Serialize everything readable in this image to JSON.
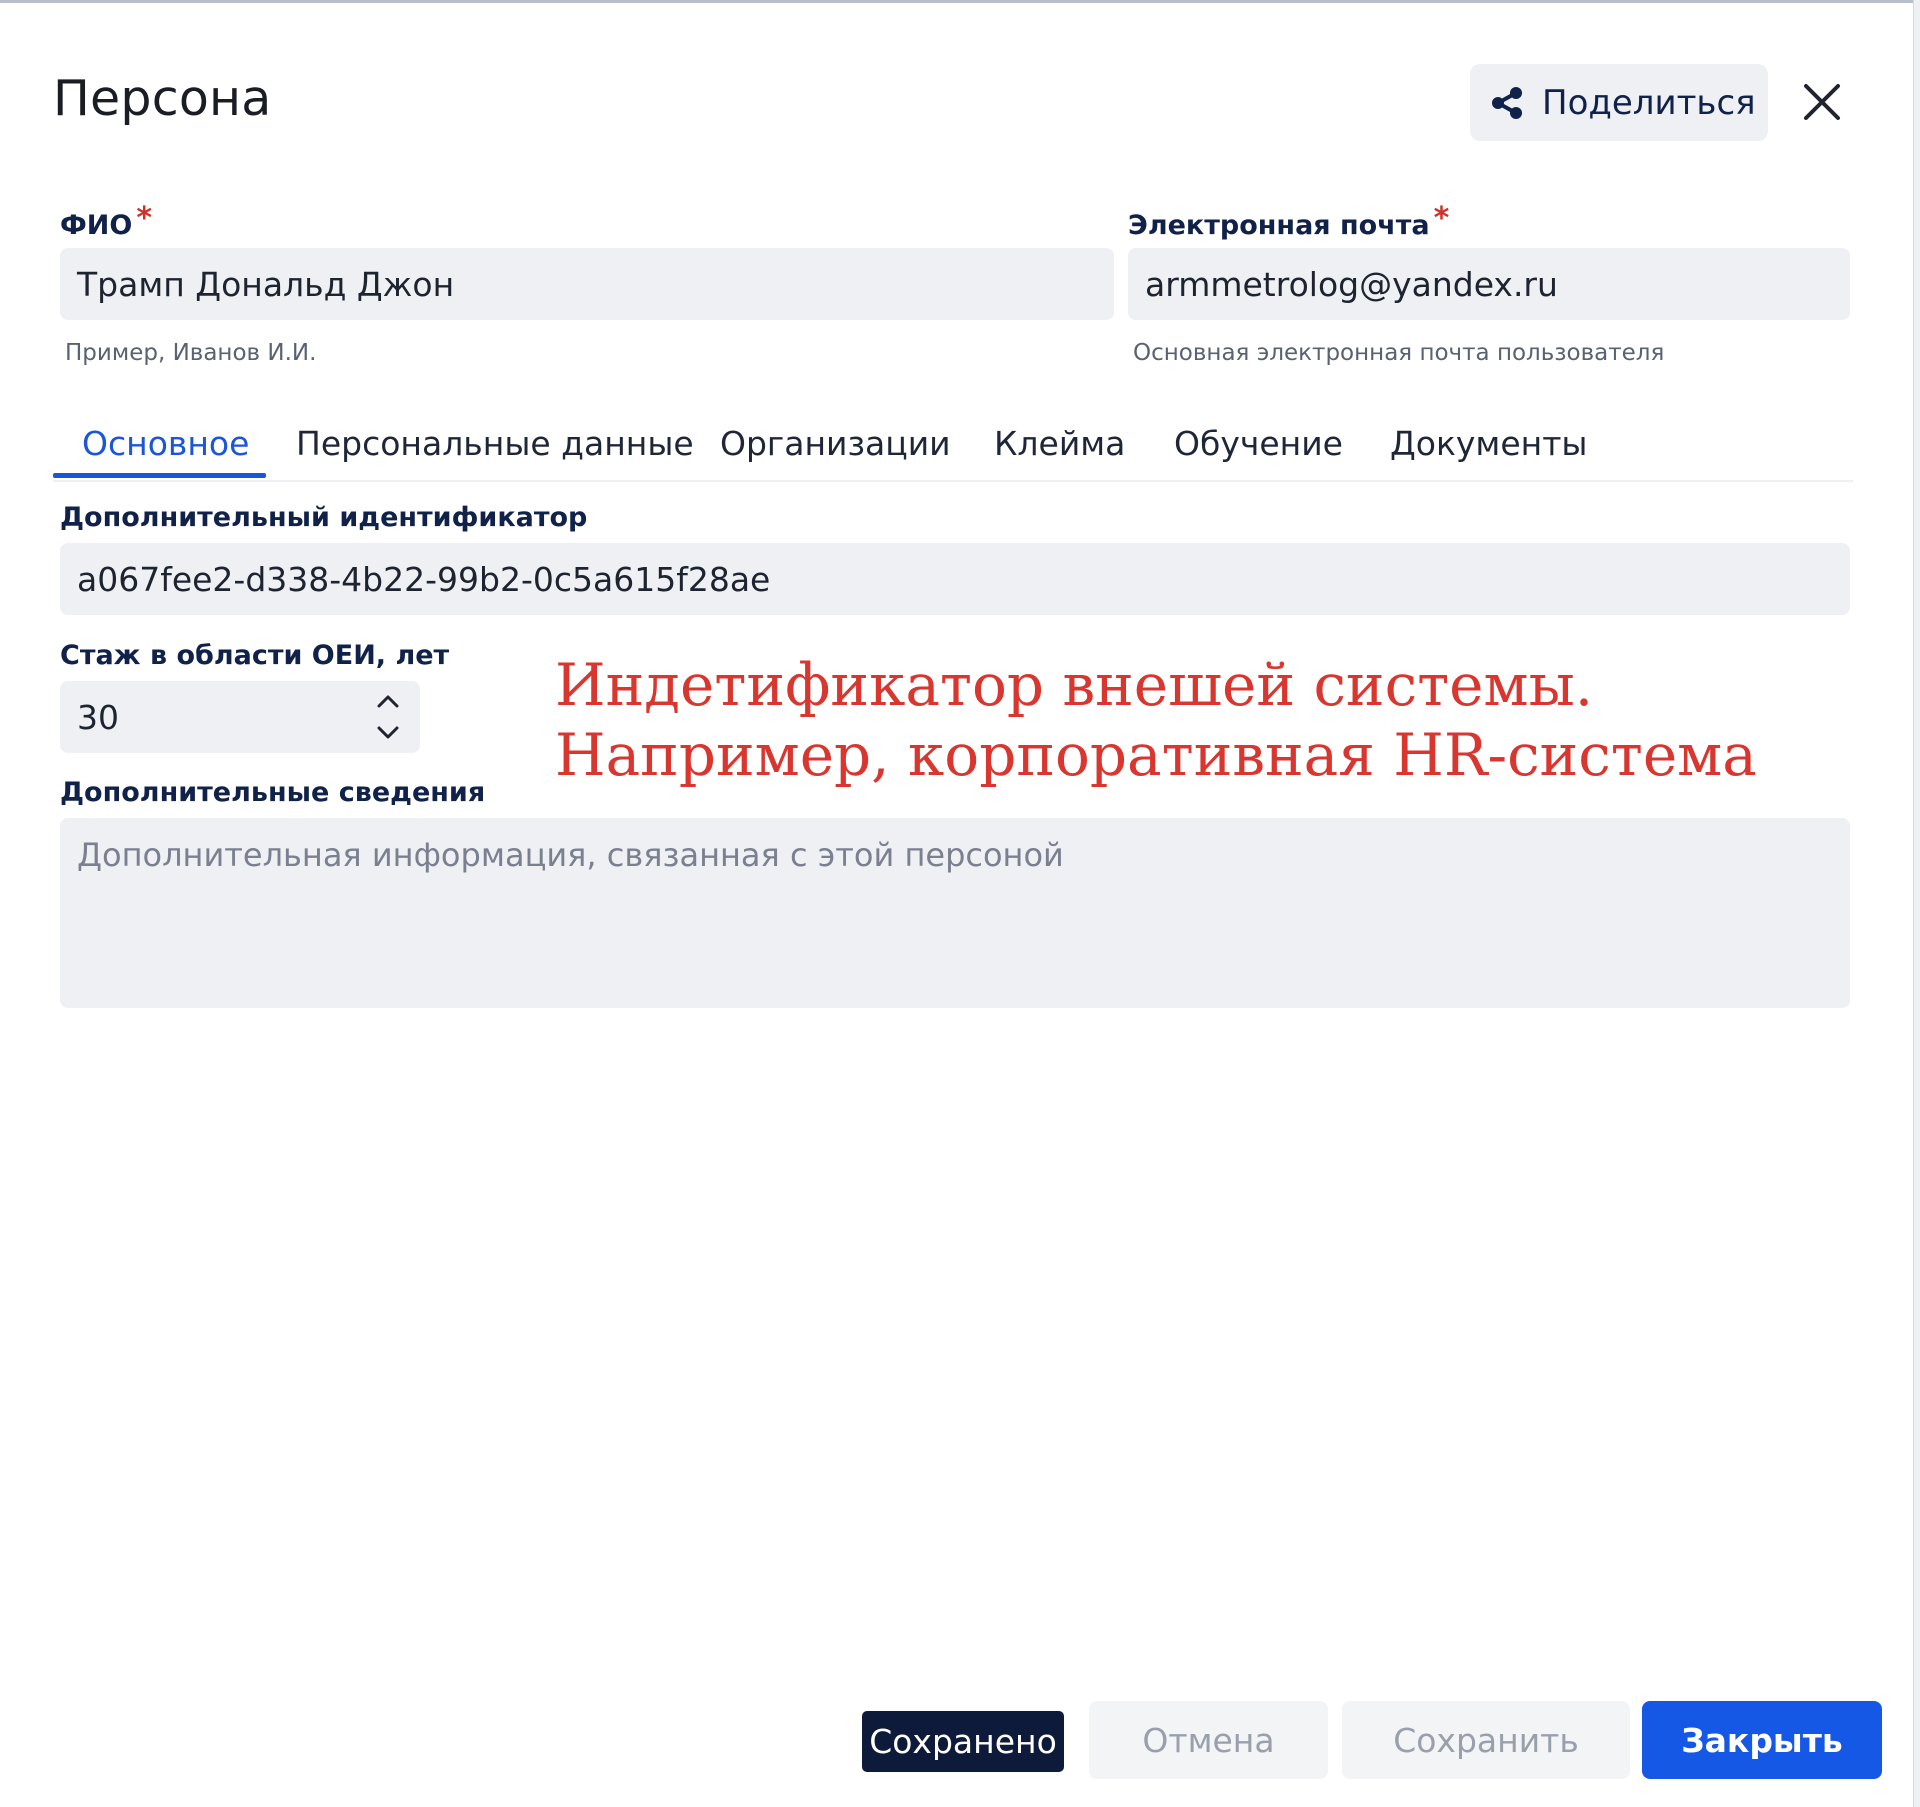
{
  "dialog": {
    "title": "Персона",
    "share_label": "Поделиться"
  },
  "fields": {
    "fio": {
      "label": "ФИО",
      "required_mark": "*",
      "value": "Трамп Дональд Джон",
      "hint": "Пример, Иванов И.И."
    },
    "email": {
      "label": "Электронная почта",
      "required_mark": "*",
      "value": "armmetrolog@yandex.ru",
      "hint": "Основная электронная почта пользователя"
    },
    "extra_id": {
      "label": "Дополнительный идентификатор",
      "value": "a067fee2-d338-4b22-99b2-0c5a615f28ae"
    },
    "experience": {
      "label": "Стаж в области ОЕИ, лет",
      "value": "30"
    },
    "extra_info": {
      "label": "Дополнительные сведения",
      "placeholder": "Дополнительная информация, связанная с этой персоной"
    }
  },
  "tabs": [
    {
      "label": "Основное",
      "active": true
    },
    {
      "label": "Персональные данные",
      "active": false
    },
    {
      "label": "Организации",
      "active": false
    },
    {
      "label": "Клейма",
      "active": false
    },
    {
      "label": "Обучение",
      "active": false
    },
    {
      "label": "Документы",
      "active": false
    }
  ],
  "annotation": {
    "line1": "Индетификатор внешей системы.",
    "line2": "Например, корпоративная HR-система"
  },
  "footer": {
    "saved_label": "Сохранено",
    "cancel_label": "Отмена",
    "save_label": "Сохранить",
    "close_label": "Закрыть"
  },
  "colors": {
    "accent": "#1a56d6",
    "primary_button": "#1558e6",
    "required": "#d0302a",
    "annotation": "#d8362f",
    "field_bg": "#eef0f3"
  }
}
